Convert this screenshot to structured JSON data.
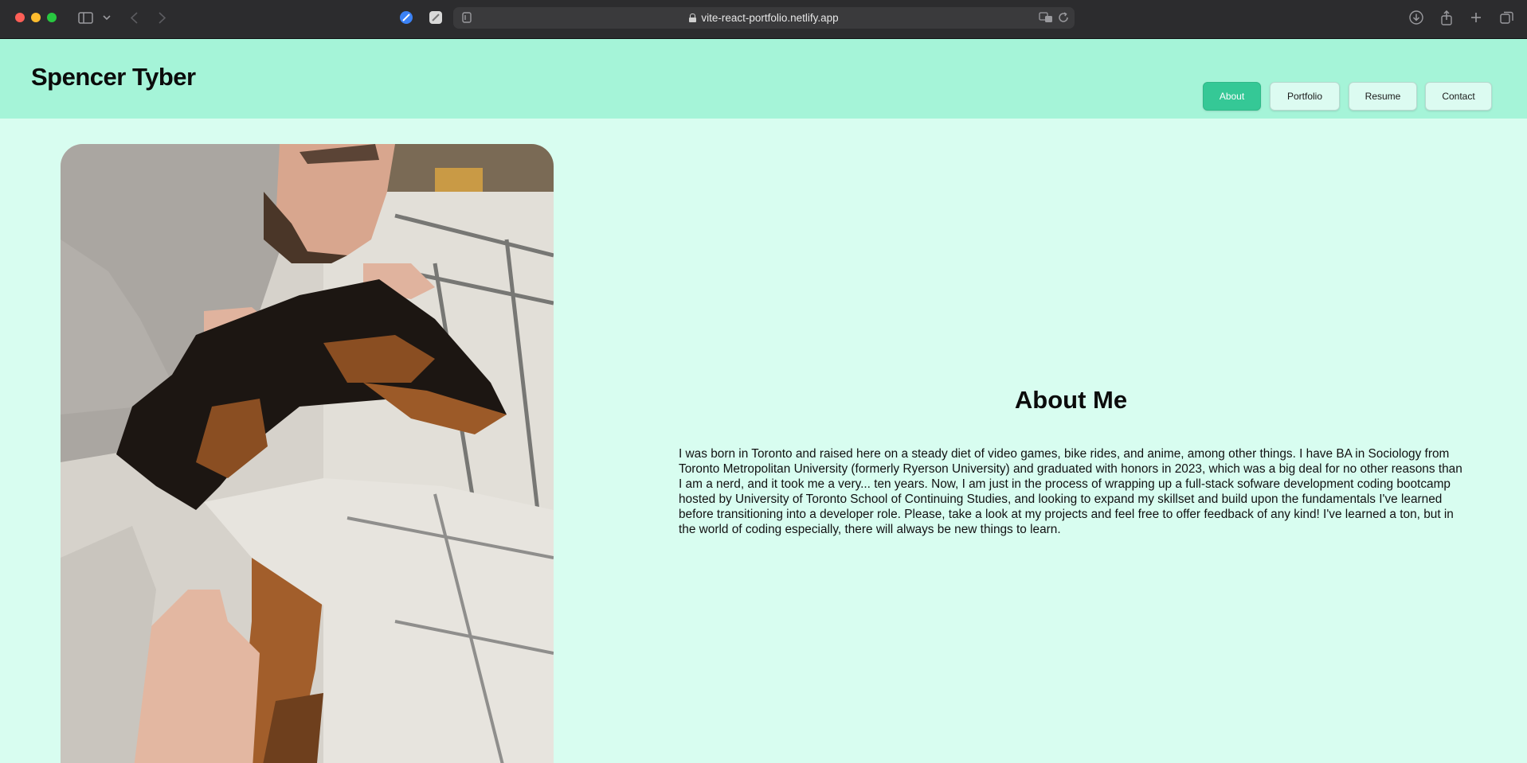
{
  "browser": {
    "url": "vite-react-portfolio.netlify.app"
  },
  "header": {
    "title": "Spencer Tyber",
    "nav": [
      {
        "label": "About",
        "active": true
      },
      {
        "label": "Portfolio",
        "active": false
      },
      {
        "label": "Resume",
        "active": false
      },
      {
        "label": "Contact",
        "active": false
      }
    ]
  },
  "about": {
    "heading": "About Me",
    "body": "I was born in Toronto and raised here on a steady diet of video games, bike rides, and anime, among other things. I have BA in Sociology from Toronto Metropolitan University (formerly Ryerson University) and graduated with honors in 2023, which was a big deal for no other reasons than I am a nerd, and it took me a very... ten years. Now, I am just in the process of wrapping up a full-stack sofware development coding bootcamp hosted by University of Toronto School of Continuing Studies, and looking to expand my skillset and build upon the fundamentals I've learned before transitioning into a developer role. Please, take a look at my projects and feel free to offer feedback of any kind! I've learned a ton, but in the world of coding especially, there will always be new things to learn."
  },
  "colors": {
    "page_bg": "#d8fdf0",
    "header_bg": "#a5f4d8",
    "accent": "#35c896"
  }
}
